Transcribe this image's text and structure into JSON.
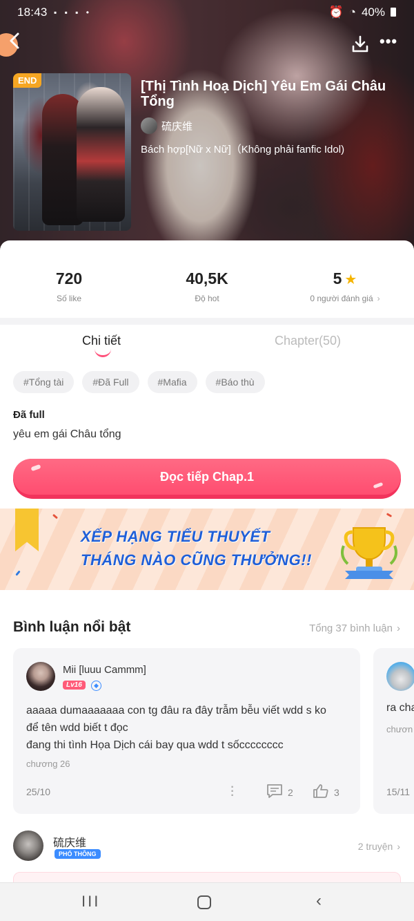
{
  "status_bar": {
    "time": "18:43",
    "battery": "40%"
  },
  "novel": {
    "tag_end": "END",
    "title": "[Thị Tình Hoạ Dịch] Yêu Em Gái Châu Tổng",
    "author": "硫庆维",
    "genre": "Bách hợp[Nữ x Nữ]（Không phải fanfic Idol)"
  },
  "stats": [
    {
      "value": "720",
      "label": "Số like"
    },
    {
      "value": "40,5K",
      "label": "Độ hot"
    },
    {
      "value": "5",
      "label": "0 người đánh giá"
    }
  ],
  "tabs": {
    "details": "Chi tiết",
    "chapters": "Chapter(50)"
  },
  "tags": [
    "#Tổng tài",
    "#Đã Full",
    "#Mafia",
    "#Báo thù"
  ],
  "status_label": "Đã full",
  "description": "yêu em gái Châu tổng",
  "read_button": "Đọc tiếp Chap.1",
  "banner": {
    "line1": "XẾP HẠNG TIỂU THUYẾT",
    "line2": "THÁNG NÀO CŨNG THƯỞNG!!"
  },
  "comments_section": {
    "title": "Bình luận nổi bật",
    "total": "Tổng 37 bình luận"
  },
  "comments": [
    {
      "name": "Mii [luuu Cammm]",
      "level": "Lv16",
      "lines": [
        "aaaaa dumaaaaaaa con tg đâu ra đây trẫm bễu viết wdd s ko",
        "để tên wdd biết t đọc",
        "đang thi tình Họa Dịch cái bay qua wdd t sốcccccccc"
      ],
      "chapter": "chương 26",
      "date": "25/10",
      "comment_count": "2",
      "like_count": "3"
    },
    {
      "text": "ra cha",
      "chapter": "chươn",
      "date": "15/11"
    }
  ],
  "author_row": {
    "name": "硫庆维",
    "badge": "PHỔ THÔNG",
    "books": "2 truyện"
  }
}
